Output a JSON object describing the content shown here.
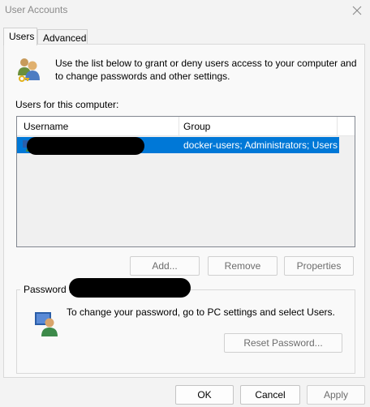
{
  "window": {
    "title": "User Accounts",
    "close_icon": "close-icon"
  },
  "tabs": [
    {
      "label": "Users",
      "active": true
    },
    {
      "label": "Advanced",
      "active": false
    }
  ],
  "intro": {
    "icon": "users-icon",
    "text": "Use the list below to grant or deny users access to your computer and to change passwords and other settings."
  },
  "users_list": {
    "label": "Users for this computer:",
    "columns": [
      "Username",
      "Group"
    ],
    "rows": [
      {
        "username": "",
        "group": "docker-users; Administrators; Users",
        "selected": true
      }
    ]
  },
  "list_buttons": {
    "add": "Add...",
    "remove": "Remove",
    "properties": "Properties"
  },
  "password": {
    "group_title": "Password f",
    "icon": "password-user-icon",
    "text": "To change your password, go to PC settings and select Users.",
    "reset_label": "Reset Password..."
  },
  "dialog_buttons": {
    "ok": "OK",
    "cancel": "Cancel",
    "apply": "Apply"
  },
  "colors": {
    "selection": "#0078d7",
    "panel": "#f9f9f9",
    "window": "#f3f3f3"
  }
}
